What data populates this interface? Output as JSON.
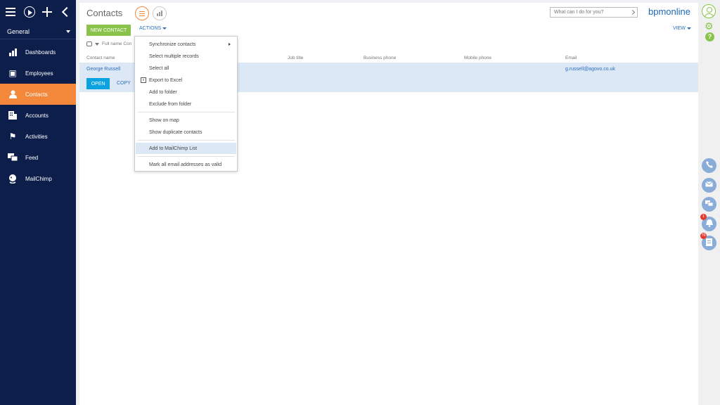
{
  "sidebar": {
    "workspace": "General",
    "items": [
      {
        "label": "Dashboards",
        "icon": "bar-chart-icon"
      },
      {
        "label": "Employees",
        "icon": "id-card-icon"
      },
      {
        "label": "Contacts",
        "icon": "person-icon"
      },
      {
        "label": "Accounts",
        "icon": "building-icon"
      },
      {
        "label": "Activities",
        "icon": "flag-icon"
      },
      {
        "label": "Feed",
        "icon": "chat-icon"
      },
      {
        "label": "MailChimp",
        "icon": "mailchimp-icon"
      }
    ],
    "active_index": 2
  },
  "header": {
    "title": "Contacts",
    "search_placeholder": "What can I do for you?",
    "brand": "bpmonline"
  },
  "toolbar": {
    "new_label": "NEW CONTACT",
    "actions_label": "ACTIONS",
    "view_label": "VIEW"
  },
  "filter": {
    "text": "Full name Con"
  },
  "grid": {
    "columns": [
      "Contact name",
      "Job title",
      "Business phone",
      "Mobile phone",
      "Email"
    ],
    "rows": [
      {
        "name": "George Russell",
        "job_title": "",
        "business_phone": "",
        "mobile_phone": "",
        "email": "g.russell@agovo.co.uk"
      }
    ],
    "open_label": "OPEN",
    "copy_label": "COPY"
  },
  "actions_menu": {
    "items": [
      "Synchronize contacts",
      "Select multiple records",
      "Select all",
      "Export to Excel",
      "Add to folder",
      "Exclude from folder",
      "Show on map",
      "Show duplicate contacts",
      "Add to MailChimp List",
      "Mark all email addresses as valid"
    ],
    "highlighted_index": 8
  },
  "right_panel": {
    "help_label": "?",
    "notifications_badge": "1",
    "tasks_badge": "76"
  },
  "colors": {
    "sidebar_bg": "#0d1e4a",
    "accent_orange": "#f3883b",
    "new_button_green": "#8bc34a",
    "open_button_blue": "#0aa3e0",
    "link_blue": "#2a6ebb",
    "selection_bg": "#dde8f6"
  }
}
